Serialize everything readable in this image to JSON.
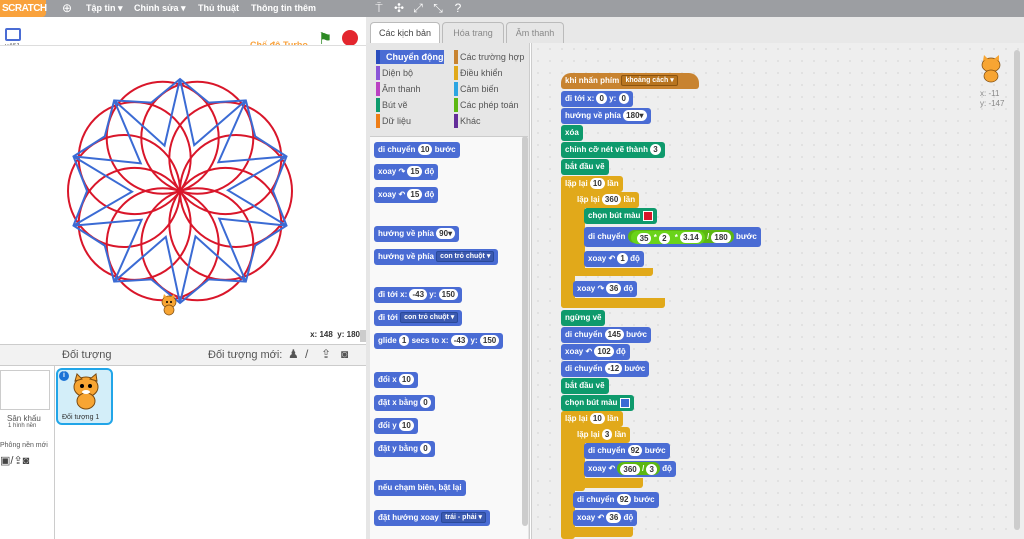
{
  "topbar": {
    "logo": "SCRATCH",
    "menus": [
      "Tập tin ▾",
      "Chỉnh sửa ▾",
      "Thủ thuật",
      "Thông tin thêm"
    ]
  },
  "stage": {
    "version": "v461",
    "turbo": "Chế độ Turbo",
    "coords_x_label": "x:",
    "coords_x": "148",
    "coords_y_label": "y:",
    "coords_y": "180"
  },
  "sprites": {
    "title": "Đối tượng",
    "new_label": "Đối tượng mới:",
    "stage_label": "Sân khấu",
    "stage_count": "1 hình nền",
    "new_backdrop": "Phông nền mới",
    "sprite1": "Đối tượng 1"
  },
  "tabs": [
    "Các kịch bản",
    "Hóa trang",
    "Âm thanh"
  ],
  "categories": {
    "left": [
      "Chuyển động",
      "Diện bộ",
      "Âm thanh",
      "Bút vẽ",
      "Dữ liệu"
    ],
    "right": [
      "Các trường hợp",
      "Điều khiển",
      "Cảm biến",
      "Các phép toán",
      "Khác"
    ]
  },
  "palette": {
    "move": "di chuyển",
    "move_val": "10",
    "move_unit": "bước",
    "turn_right": "xoay ↷",
    "turn_r_val": "15",
    "turn_unit": "độ",
    "turn_left": "xoay ↶",
    "turn_l_val": "15",
    "point_dir": "hướng về phía",
    "point_val": "90▾",
    "point_towards": "hướng về phía",
    "towards_val": "con trỏ chuột ▾",
    "goto_xy": "đi tới x:",
    "goto_x": "-43",
    "goto_y_label": "y:",
    "goto_y": "150",
    "goto": "đi tới",
    "goto_val": "con trỏ chuột ▾",
    "glide": "glide",
    "glide_secs": "1",
    "glide_text": "secs to x:",
    "glide_x": "-43",
    "glide_y_label": "y:",
    "glide_y": "150",
    "change_x": "đổi x",
    "change_x_val": "10",
    "set_x": "đặt x bằng",
    "set_x_val": "0",
    "change_y": "đổi y",
    "change_y_val": "10",
    "set_y": "đặt y bằng",
    "set_y_val": "0",
    "bounce": "nếu chạm biên, bật lại",
    "rotation": "đặt hướng xoay",
    "rotation_val": "trái - phải ▾"
  },
  "script": {
    "hat": "khi nhấn phím",
    "hat_key": "khoảng cách ▾",
    "goto_xy": "đi tới x:",
    "gx": "0",
    "gy_label": "y:",
    "gy": "0",
    "point": "hướng về phía",
    "point_val": "180▾",
    "clear": "xóa",
    "pen_size": "chỉnh cỡ nét vẽ thành",
    "pen_size_val": "3",
    "pen_down": "bắt đầu vẽ",
    "repeat1": "lặp lại",
    "repeat1_val": "10",
    "repeat_unit": "lần",
    "repeat2_val": "360",
    "set_color": "chọn bút màu",
    "move": "di chuyển",
    "m1": "35",
    "m2": "2",
    "m3": "3.14",
    "m4": "180",
    "step": "bước",
    "op_mul": "*",
    "op_div": "/",
    "turn_left": "xoay ↶",
    "tl_val": "1",
    "deg": "độ",
    "turn_right": "xoay ↷",
    "tr_val": "36",
    "pen_up": "ngừng vẽ",
    "move2_val": "145",
    "turn2_val": "102",
    "move3_val": "-12",
    "repeat3_val": "10",
    "repeat4_val": "3",
    "move4_val": "92",
    "turn4_a": "360",
    "turn4_b": "3",
    "move5_val": "92",
    "turn5_val": "36",
    "sprite_x": "x: -11",
    "sprite_y": "y: -147"
  },
  "colors": {
    "red_pen": "#d9162a",
    "blue_pen": "#3b6bd4"
  }
}
